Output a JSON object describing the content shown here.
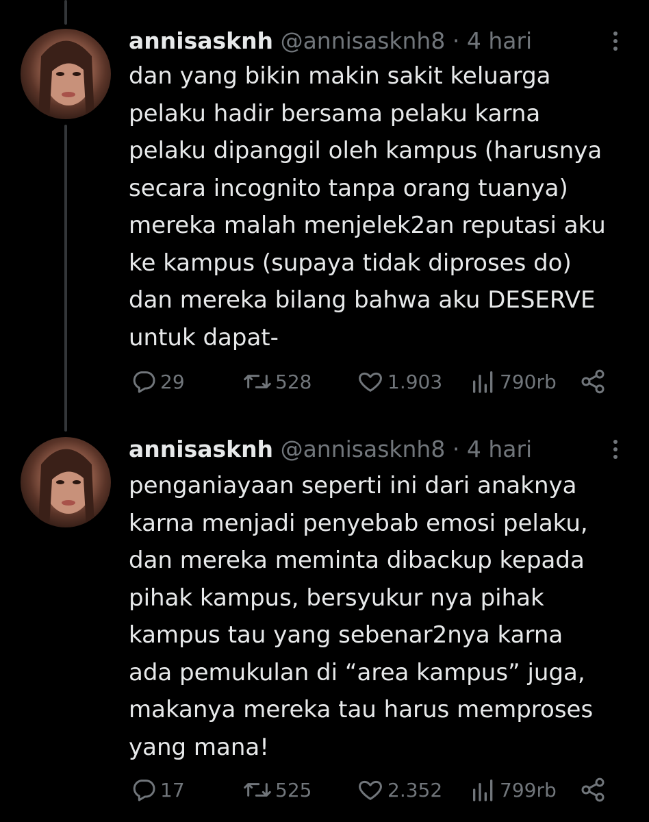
{
  "tweets": [
    {
      "name": "annisasknh",
      "handle": "@annisasknh8",
      "separator": "·",
      "time": "4 hari",
      "text": "dan yang bikin makin sakit keluarga\npelaku hadir bersama pelaku karna\npelaku dipanggil oleh kampus (harusnya\nsecara incognito tanpa orang tuanya)\nmereka malah menjelek2an reputasi aku\nke kampus (supaya tidak diproses do)\ndan mereka bilang bahwa aku DESERVE\nuntuk dapat-",
      "replies": "29",
      "retweets": "528",
      "likes": "1.903",
      "views": "790rb"
    },
    {
      "name": "annisasknh",
      "handle": "@annisasknh8",
      "separator": "·",
      "time": "4 hari",
      "text": "penganiayaan seperti ini dari anaknya\nkarna menjadi penyebab emosi pelaku,\ndan mereka meminta dibackup kepada\npihak kampus, bersyukur nya pihak\nkampus tau yang sebenar2nya karna\nada pemukulan di “area kampus” juga,\nmakanya mereka tau harus memproses\nyang mana!",
      "replies": "17",
      "retweets": "525",
      "likes": "2.352",
      "views": "799rb"
    }
  ],
  "icons": {
    "reply": "reply-icon",
    "retweet": "retweet-icon",
    "like": "heart-icon",
    "views": "views-icon",
    "share": "share-icon",
    "more": "more-icon"
  },
  "colors": {
    "background": "#000000",
    "text": "#e7e9ea",
    "muted": "#71767b",
    "thread_line": "#333639"
  }
}
